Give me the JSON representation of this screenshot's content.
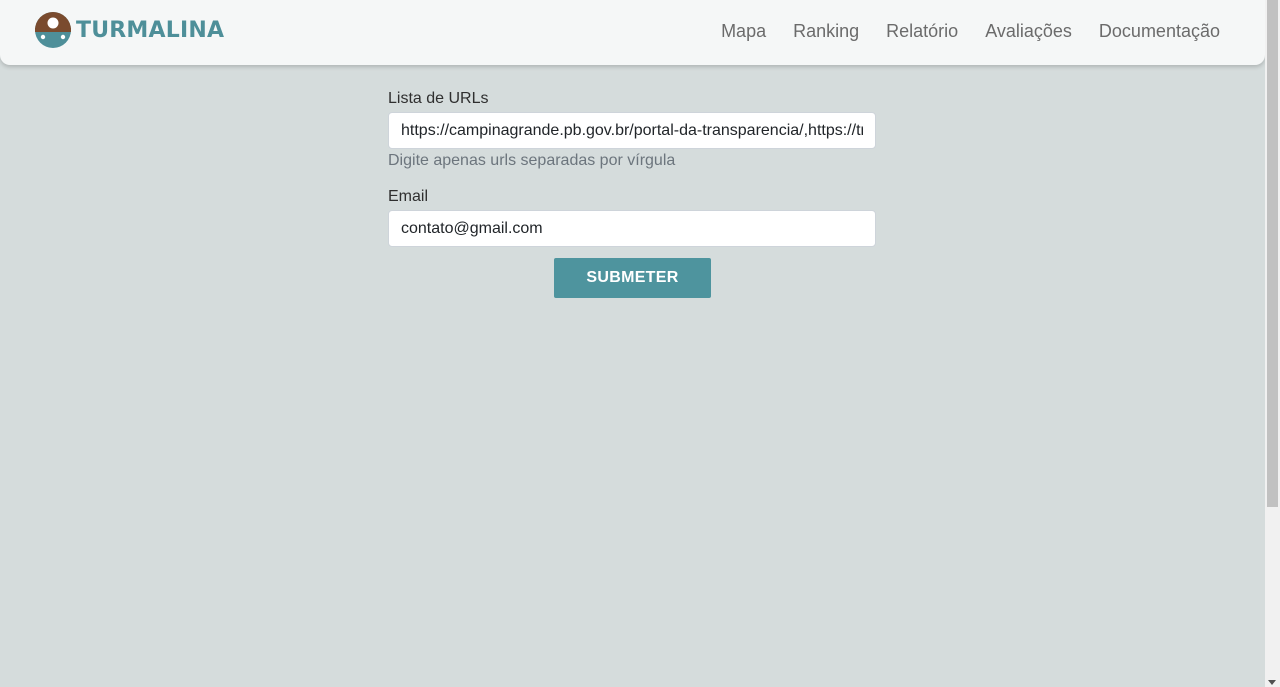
{
  "brand": {
    "name": "TURMALINA",
    "logo_icon": "mushroom-logo-icon"
  },
  "nav": {
    "links": [
      {
        "label": "Mapa"
      },
      {
        "label": "Ranking"
      },
      {
        "label": "Relatório"
      },
      {
        "label": "Avaliações"
      },
      {
        "label": "Documentação"
      }
    ]
  },
  "form": {
    "urls": {
      "label": "Lista de URLs",
      "value": "https://campinagrande.pb.gov.br/portal-da-transparencia/,https://tra",
      "help": "Digite apenas urls separadas por vírgula"
    },
    "email": {
      "label": "Email",
      "value": "contato@gmail.com"
    },
    "submit_label": "SUBMETER"
  },
  "colors": {
    "background": "#d5dcdc",
    "navbar": "#f5f7f7",
    "brand_teal": "#4e8f99",
    "logo_brown": "#7a4b2e",
    "button": "#4e949e"
  }
}
